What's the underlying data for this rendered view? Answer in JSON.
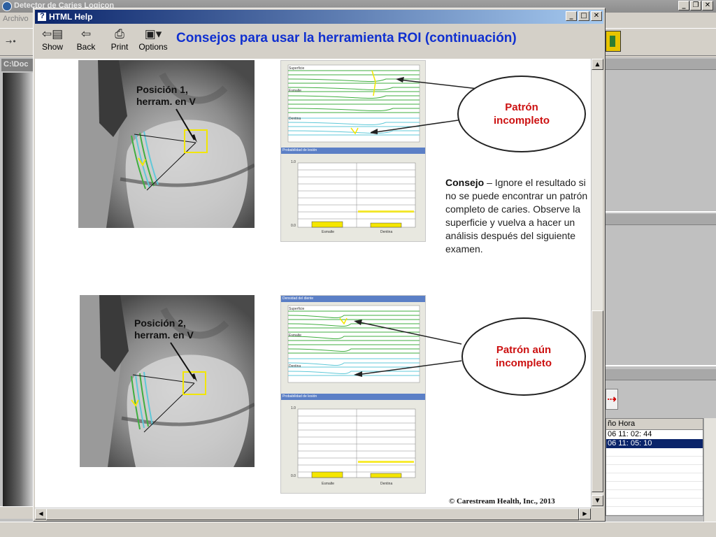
{
  "background_app": {
    "title": "Detector de Caries Logicon",
    "menu_first": "Archivo",
    "path_label": "C:\\Doc",
    "table": {
      "header": "ño Hora",
      "rows": [
        {
          "text": "06   11: 02: 44",
          "selected": false
        },
        {
          "text": "06   11: 05: 10",
          "selected": true
        }
      ]
    }
  },
  "help_window": {
    "title": "HTML Help",
    "toolbar": {
      "show": "Show",
      "back": "Back",
      "print": "Print",
      "options": "Options"
    },
    "heading": "Consejos para usar la herramienta ROI (continuación)"
  },
  "content": {
    "panel1": {
      "xray_label": "Posición 1,\nherram. en V",
      "graph_labels": {
        "surface": "Superficie",
        "enamel": "Esmalte",
        "dentin": "Dentina",
        "prob_title": "Probabilidad de lesión",
        "y_top": "1.0",
        "y_bottom": "0.0",
        "bar1": "Esmalte",
        "bar2": "Dentina"
      },
      "callout": "Patrón\nincompleto"
    },
    "tip": {
      "bold": "Consejo",
      "text": " – Ignore el resultado si no se puede encontrar un patrón completo de caries. Observe la superficie y vuelva a hacer un análisis después del siguiente examen."
    },
    "panel2": {
      "xray_label": "Posición 2,\nherram. en V",
      "graph_labels": {
        "title": "Densidad del diente",
        "surface": "Superficie",
        "enamel": "Esmalte",
        "dentin": "Dentina",
        "prob_title": "Probabilidad de lesión",
        "y_top": "1.0",
        "y_bottom": "0.0",
        "bar1": "Esmalte",
        "bar2": "Dentina"
      },
      "callout": "Patrón aún\nincompleto"
    },
    "copyright": "© Carestream Health, Inc., 2013"
  },
  "colors": {
    "heading_blue": "#1030d0",
    "callout_red": "#cc1010",
    "titlebar_active": "#0a246a",
    "graph_line_green": "#3fae3f",
    "graph_line_cyan": "#5fc8d8",
    "bar_yellow": "#f5e600",
    "roi_yellow": "#f2e600"
  },
  "icons": {
    "show": "show-icon",
    "back": "back-arrow-icon",
    "print": "printer-icon",
    "options": "options-icon"
  }
}
